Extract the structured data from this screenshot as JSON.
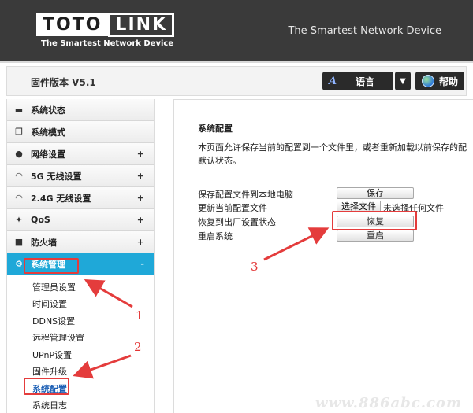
{
  "header": {
    "logo_toto": "TOTO",
    "logo_link": "LINK",
    "logo_tagline": "The Smartest Network Device",
    "tagline": "The Smartest Network Device"
  },
  "topbar": {
    "firmware": "固件版本 V5.1",
    "language_label": "语言",
    "help_label": "帮助"
  },
  "sidebar": {
    "items": [
      {
        "label": "系统状态",
        "icon": "status-icon",
        "plus": ""
      },
      {
        "label": "系统模式",
        "icon": "mode-icon",
        "plus": ""
      },
      {
        "label": "网络设置",
        "icon": "globe-icon",
        "plus": "+"
      },
      {
        "label": "5G  无线设置",
        "icon": "wifi-icon",
        "plus": "+"
      },
      {
        "label": "2.4G  无线设置",
        "icon": "wifi-icon",
        "plus": "+"
      },
      {
        "label": "QoS",
        "icon": "qos-icon",
        "plus": "+"
      },
      {
        "label": "防火墙",
        "icon": "lock-icon",
        "plus": "+"
      },
      {
        "label": "系统管理",
        "icon": "gear-icon",
        "plus": "-"
      }
    ],
    "submenu": [
      "管理员设置",
      "时间设置",
      "DDNS设置",
      "远程管理设置",
      "UPnP设置",
      "固件升级",
      "系统配置",
      "系统日志"
    ]
  },
  "main": {
    "title": "系统配置",
    "description_line1": "本页面允许保存当前的配置到一个文件里，或者重新加载以前保存的配",
    "description_line2": "默认状态。",
    "rows": [
      {
        "label": "保存配置文件到本地电脑",
        "button": "保存"
      },
      {
        "label": "更新当前配置文件",
        "file_button": "选择文件",
        "file_status": "未选择任何文件"
      },
      {
        "label": "恢复到出厂设置状态",
        "button": "恢复"
      },
      {
        "label": "重启系统",
        "button": "重启"
      }
    ]
  },
  "annotations": {
    "num1": "1",
    "num2": "2",
    "num3": "3"
  },
  "watermark": "www.886abc.com",
  "colors": {
    "active_menu": "#1fa8d8",
    "annotation_red": "#e43c3c",
    "header_bg": "#3a3a3a"
  }
}
